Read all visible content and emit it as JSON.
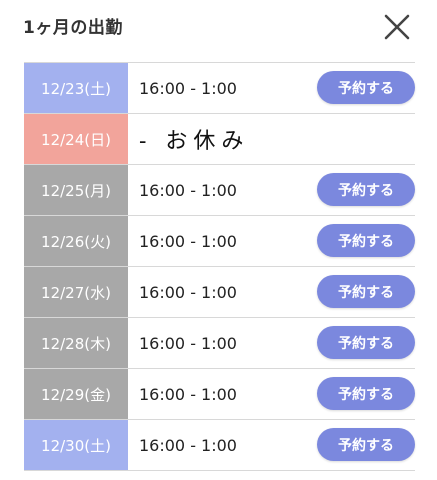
{
  "header": {
    "title": "1ヶ月の出勤",
    "close_icon": "close-icon"
  },
  "colors": {
    "saturday": "#a3b1ef",
    "sunday": "#f2a49b",
    "weekday": "#a8a8a8",
    "button": "#7b88de"
  },
  "schedule": [
    {
      "date": "12/23(土)",
      "kind": "saturday",
      "time": "16:00 - 1:00",
      "button": "予約する"
    },
    {
      "date": "12/24(日)",
      "kind": "sunday",
      "rest": "- お休み"
    },
    {
      "date": "12/25(月)",
      "kind": "weekday",
      "time": "16:00 - 1:00",
      "button": "予約する"
    },
    {
      "date": "12/26(火)",
      "kind": "weekday",
      "time": "16:00 - 1:00",
      "button": "予約する"
    },
    {
      "date": "12/27(水)",
      "kind": "weekday",
      "time": "16:00 - 1:00",
      "button": "予約する"
    },
    {
      "date": "12/28(木)",
      "kind": "weekday",
      "time": "16:00 - 1:00",
      "button": "予約する"
    },
    {
      "date": "12/29(金)",
      "kind": "weekday",
      "time": "16:00 - 1:00",
      "button": "予約する"
    },
    {
      "date": "12/30(土)",
      "kind": "saturday",
      "time": "16:00 - 1:00",
      "button": "予約する"
    }
  ]
}
